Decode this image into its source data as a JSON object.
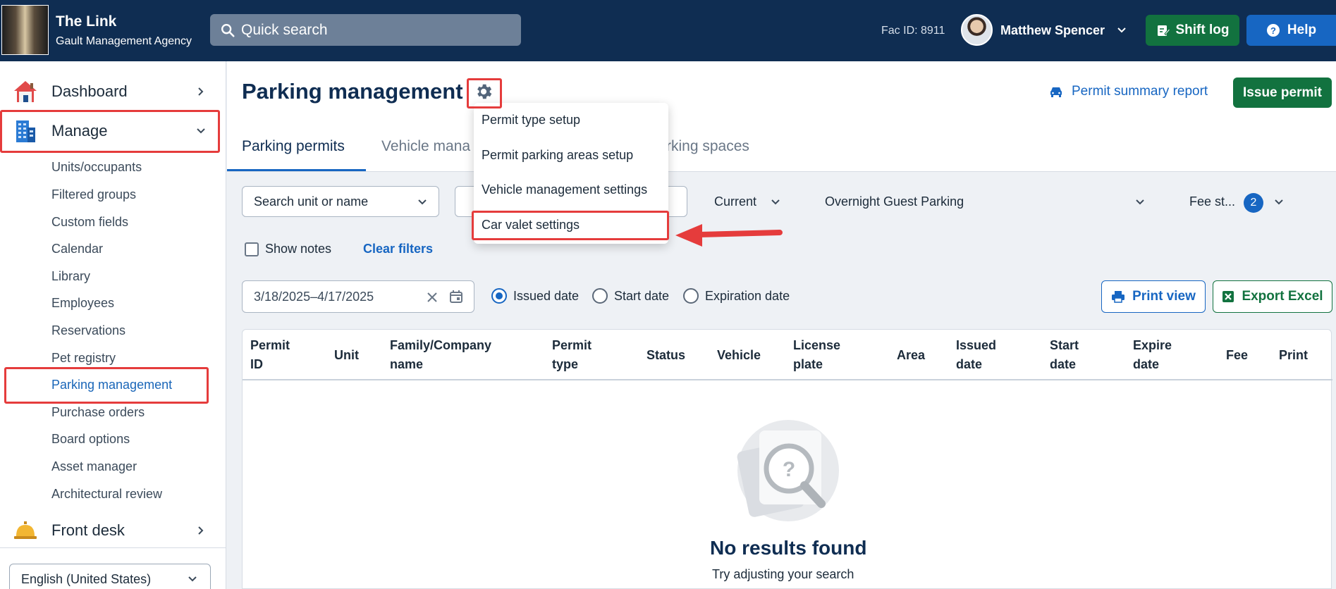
{
  "header": {
    "brand_title": "The Link",
    "brand_subtitle": "Gault Management Agency",
    "search_placeholder": "Quick search",
    "fac_id": "Fac ID: 8911",
    "user_name": "Matthew Spencer",
    "shift_log_label": "Shift log",
    "help_label": "Help"
  },
  "sidebar": {
    "dashboard_label": "Dashboard",
    "manage_label": "Manage",
    "manage_items": [
      "Units/occupants",
      "Filtered groups",
      "Custom fields",
      "Calendar",
      "Library",
      "Employees",
      "Reservations",
      "Pet registry",
      "Parking management",
      "Purchase orders",
      "Board options",
      "Asset manager",
      "Architectural review"
    ],
    "active_item": "Parking management",
    "front_desk_label": "Front desk",
    "language": "English (United States)"
  },
  "page": {
    "title": "Parking management",
    "permit_summary_label": "Permit summary report",
    "issue_permit_label": "Issue permit",
    "tabs": [
      "Parking permits",
      "Vehicle mana",
      "rking spaces"
    ]
  },
  "settings_menu": {
    "items": [
      "Permit type setup",
      "Permit parking areas setup",
      "Vehicle management settings",
      "Car valet settings"
    ]
  },
  "filters": {
    "unit_search_placeholder": "Search unit or name",
    "status_value": "Current",
    "area_value": "Overnight Guest Parking",
    "fee_status_label": "Fee st...",
    "fee_status_count": "2",
    "show_notes_label": "Show notes",
    "clear_filters_label": "Clear filters",
    "date_range": "3/18/2025–4/17/2025",
    "date_options": [
      "Issued date",
      "Start date",
      "Expiration date"
    ],
    "selected_date_option": "Issued date",
    "print_view_label": "Print view",
    "export_excel_label": "Export Excel"
  },
  "table": {
    "columns": [
      [
        "Permit",
        "ID"
      ],
      [
        "Unit"
      ],
      [
        "Family/Company",
        "name"
      ],
      [
        "Permit",
        "type"
      ],
      [
        "Status"
      ],
      [
        "Vehicle"
      ],
      [
        "License",
        "plate"
      ],
      [
        "Area"
      ],
      [
        "Issued",
        "date"
      ],
      [
        "Start",
        "date"
      ],
      [
        "Expire",
        "date"
      ],
      [
        "Fee"
      ],
      [
        "Print"
      ]
    ],
    "empty_title": "No results found",
    "empty_subtitle": "Try adjusting your search"
  },
  "colors": {
    "header_bg": "#0f2d52",
    "accent_blue": "#1766c2",
    "accent_green": "#12723f",
    "annotation_red": "#e53c3c"
  }
}
